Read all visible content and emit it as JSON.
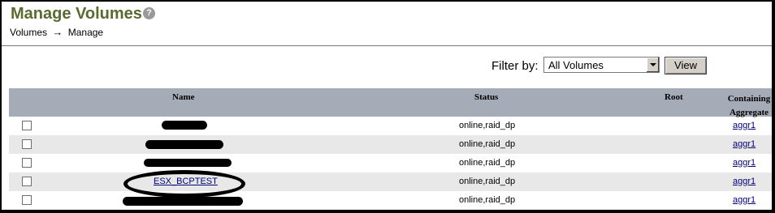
{
  "page": {
    "title": "Manage Volumes",
    "help_glyph": "?"
  },
  "breadcrumb": {
    "root": "Volumes",
    "separator": "→",
    "current": "Manage"
  },
  "filter": {
    "label": "Filter by:",
    "selected": "All Volumes",
    "button_label": "View"
  },
  "table": {
    "columns": {
      "name": "Name",
      "status": "Status",
      "root": "Root",
      "aggregate": "Containing Aggregate"
    },
    "rows": [
      {
        "name": "",
        "name_redacted": true,
        "status": "online,raid_dp",
        "root": "",
        "aggregate": "aggr1"
      },
      {
        "name": "",
        "name_redacted": true,
        "status": "online,raid_dp",
        "root": "",
        "aggregate": "aggr1"
      },
      {
        "name": "",
        "name_redacted": true,
        "status": "online,raid_dp",
        "root": "",
        "aggregate": "aggr1"
      },
      {
        "name": "ESX_BCPTEST",
        "name_redacted": false,
        "highlighted": true,
        "status": "online,raid_dp",
        "root": "",
        "aggregate": "aggr1"
      },
      {
        "name": "",
        "name_redacted": true,
        "status": "online,raid_dp",
        "root": "",
        "aggregate": "aggr1"
      }
    ]
  },
  "colors": {
    "title": "#5a6b2f",
    "header_bg": "#a6acb7",
    "alt_row_bg": "#e8e8e8",
    "link": "#00007a"
  }
}
